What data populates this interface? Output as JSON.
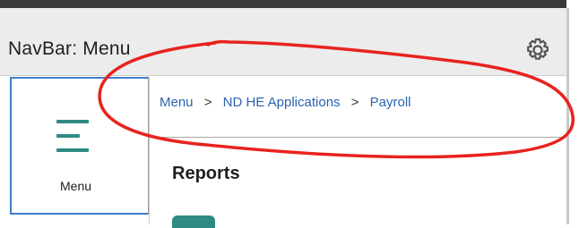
{
  "navbar": {
    "title": "NavBar: Menu",
    "gear_icon": "gear-icon"
  },
  "menu_tile": {
    "label": "Menu",
    "icon": "hamburger-menu-icon",
    "accent_color": "#2f8a84"
  },
  "breadcrumb": {
    "items": [
      "Menu",
      "ND HE Applications",
      "Payroll"
    ],
    "separator": ">",
    "link_color": "#2b63b0"
  },
  "section": {
    "title": "Reports"
  },
  "annotation": {
    "color": "#e8231e"
  }
}
